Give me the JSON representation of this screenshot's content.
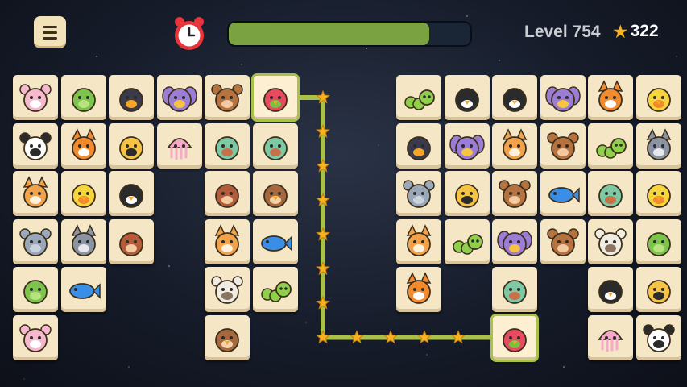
{
  "header": {
    "menu_icon": "hamburger-menu-icon",
    "timer_icon": "alarm-clock-icon",
    "progress_fraction": 0.83,
    "level_label": "Level 754",
    "score": "322",
    "score_icon": "star-icon",
    "colors": {
      "progress": "#7aa241",
      "star": "#f6b21f",
      "selected": "#a9c04a",
      "tile": "#f5e6c6"
    }
  },
  "board": {
    "tiles": [
      {
        "animal": "cow",
        "col": 0,
        "row": 0
      },
      {
        "animal": "frog",
        "col": 1,
        "row": 0
      },
      {
        "animal": "toucan",
        "col": 2,
        "row": 0
      },
      {
        "animal": "butterfly",
        "col": 3,
        "row": 0
      },
      {
        "animal": "monkey",
        "col": 4,
        "row": 0
      },
      {
        "animal": "parrot",
        "col": 5,
        "row": 0,
        "selected": true
      },
      {
        "animal": "panda",
        "col": 0,
        "row": 1
      },
      {
        "animal": "fox",
        "col": 1,
        "row": 1
      },
      {
        "animal": "bee",
        "col": 2,
        "row": 1
      },
      {
        "animal": "jellyfish",
        "col": 3,
        "row": 1
      },
      {
        "animal": "turtle",
        "col": 4,
        "row": 1
      },
      {
        "animal": "turtle",
        "col": 5,
        "row": 1
      },
      {
        "animal": "cat",
        "col": 0,
        "row": 2
      },
      {
        "animal": "duck",
        "col": 1,
        "row": 2
      },
      {
        "animal": "penguin",
        "col": 2,
        "row": 2
      },
      {
        "animal": "hedgehog",
        "col": 4,
        "row": 2
      },
      {
        "animal": "owl",
        "col": 5,
        "row": 2
      },
      {
        "animal": "elephant",
        "col": 0,
        "row": 3
      },
      {
        "animal": "wolf",
        "col": 1,
        "row": 3
      },
      {
        "animal": "hedgehog",
        "col": 2,
        "row": 3
      },
      {
        "animal": "cat",
        "col": 4,
        "row": 3
      },
      {
        "animal": "fish",
        "col": 5,
        "row": 3
      },
      {
        "animal": "frog",
        "col": 0,
        "row": 4
      },
      {
        "animal": "fish",
        "col": 1,
        "row": 4
      },
      {
        "animal": "sheep",
        "col": 4,
        "row": 4
      },
      {
        "animal": "caterpillar",
        "col": 5,
        "row": 4
      },
      {
        "animal": "cow",
        "col": 0,
        "row": 5
      },
      {
        "animal": "owl",
        "col": 4,
        "row": 5
      },
      {
        "animal": "caterpillar",
        "col": 8,
        "row": 0
      },
      {
        "animal": "penguin",
        "col": 9,
        "row": 0
      },
      {
        "animal": "penguin",
        "col": 10,
        "row": 0
      },
      {
        "animal": "butterfly",
        "col": 11,
        "row": 0
      },
      {
        "animal": "fox",
        "col": 12,
        "row": 0
      },
      {
        "animal": "duck",
        "col": 13,
        "row": 0
      },
      {
        "animal": "toucan",
        "col": 8,
        "row": 1
      },
      {
        "animal": "butterfly",
        "col": 9,
        "row": 1
      },
      {
        "animal": "cat",
        "col": 10,
        "row": 1
      },
      {
        "animal": "monkey",
        "col": 11,
        "row": 1
      },
      {
        "animal": "caterpillar",
        "col": 12,
        "row": 1
      },
      {
        "animal": "wolf",
        "col": 13,
        "row": 1
      },
      {
        "animal": "elephant",
        "col": 8,
        "row": 2
      },
      {
        "animal": "bee",
        "col": 9,
        "row": 2
      },
      {
        "animal": "monkey",
        "col": 10,
        "row": 2
      },
      {
        "animal": "fish",
        "col": 11,
        "row": 2
      },
      {
        "animal": "turtle",
        "col": 12,
        "row": 2
      },
      {
        "animal": "duck",
        "col": 13,
        "row": 2
      },
      {
        "animal": "cat",
        "col": 8,
        "row": 3
      },
      {
        "animal": "caterpillar",
        "col": 9,
        "row": 3
      },
      {
        "animal": "butterfly",
        "col": 10,
        "row": 3
      },
      {
        "animal": "monkey",
        "col": 11,
        "row": 3
      },
      {
        "animal": "sheep",
        "col": 12,
        "row": 3
      },
      {
        "animal": "frog",
        "col": 13,
        "row": 3
      },
      {
        "animal": "fox",
        "col": 8,
        "row": 4
      },
      {
        "animal": "turtle",
        "col": 10,
        "row": 4
      },
      {
        "animal": "penguin",
        "col": 12,
        "row": 4
      },
      {
        "animal": "bee",
        "col": 13,
        "row": 4
      },
      {
        "animal": "parrot",
        "col": 10,
        "row": 5,
        "selected": true
      },
      {
        "animal": "jellyfish",
        "col": 12,
        "row": 5
      },
      {
        "animal": "panda",
        "col": 13,
        "row": 5
      }
    ],
    "match_path": [
      [
        5,
        0
      ],
      [
        6,
        0
      ],
      [
        6,
        5
      ],
      [
        10,
        5
      ]
    ],
    "path_star_icon": "star-icon"
  }
}
